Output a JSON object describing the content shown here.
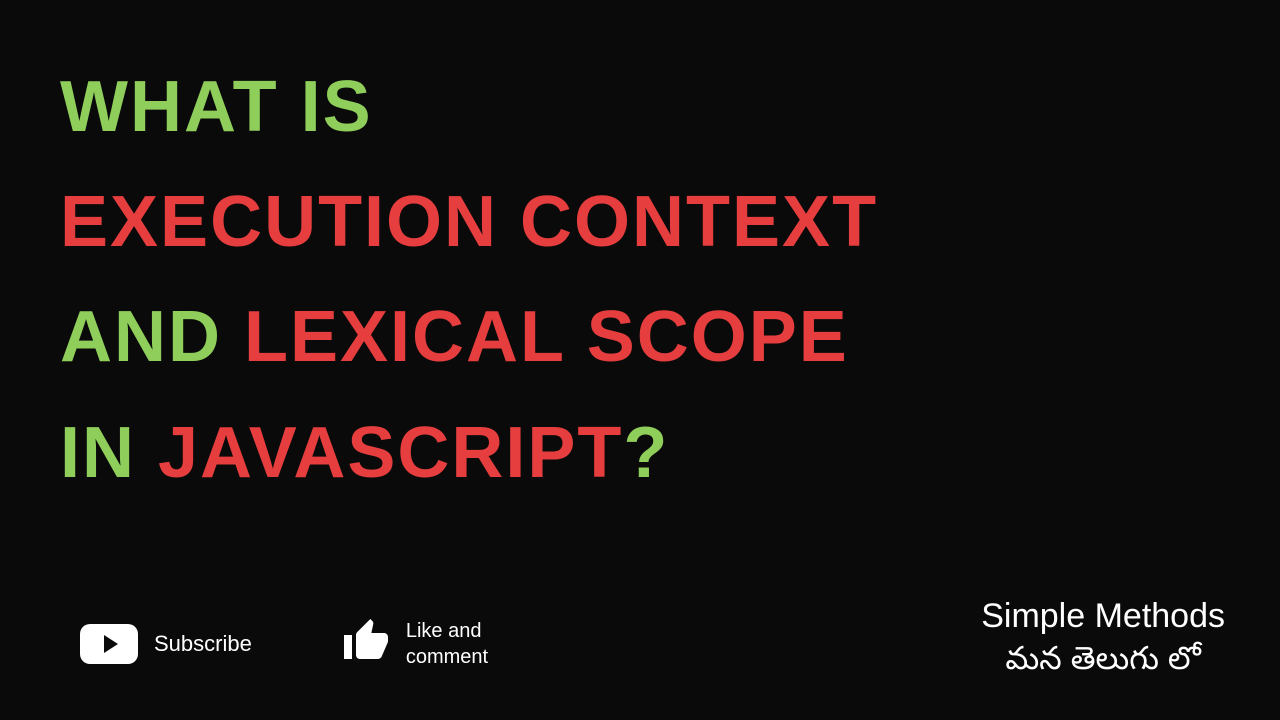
{
  "title": {
    "line1": "What is",
    "line2": "Execution Context",
    "line3_part1": "and",
    "line3_part2": "Lexical Scope",
    "line4_part1": "in",
    "line4_part2": "Javascript",
    "line4_part3": "?"
  },
  "cta": {
    "subscribe": "Subscribe",
    "like_line1": "Like and",
    "like_line2": "comment"
  },
  "channel": {
    "line1": "Simple Methods",
    "line2": "మన తెలుగు లో"
  }
}
